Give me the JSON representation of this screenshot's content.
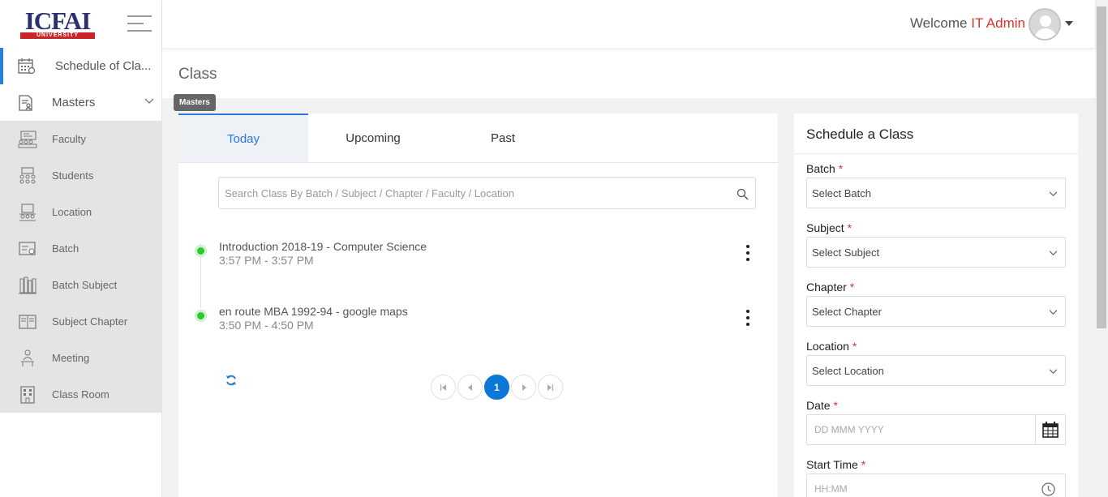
{
  "app": {
    "logo_text": "ICFAI",
    "logo_subtext": "UNIVERSITY"
  },
  "header": {
    "welcome_label": "Welcome",
    "user_name": "IT Admin"
  },
  "sidebar": {
    "items": [
      {
        "label": "Schedule of Cla...",
        "icon": "calendar-icon",
        "active": true
      },
      {
        "label": "Masters",
        "icon": "masters-icon",
        "expanded": true
      }
    ],
    "submenu": [
      {
        "label": "Faculty",
        "icon": "faculty-icon"
      },
      {
        "label": "Students",
        "icon": "students-icon"
      },
      {
        "label": "Location",
        "icon": "location-icon"
      },
      {
        "label": "Batch",
        "icon": "batch-icon"
      },
      {
        "label": "Batch Subject",
        "icon": "batch-subject-icon"
      },
      {
        "label": "Subject Chapter",
        "icon": "subject-chapter-icon"
      },
      {
        "label": "Meeting",
        "icon": "meeting-icon"
      },
      {
        "label": "Class Room",
        "icon": "class-room-icon"
      }
    ]
  },
  "tooltip": {
    "text": "Masters"
  },
  "page": {
    "title": "Class"
  },
  "tabs": [
    {
      "label": "Today",
      "active": true
    },
    {
      "label": "Upcoming"
    },
    {
      "label": "Past"
    }
  ],
  "search": {
    "placeholder": "Search Class By Batch / Subject / Chapter / Faculty / Location"
  },
  "classes": [
    {
      "title": "Introduction 2018-19 - Computer Science",
      "time": "3:57 PM - 3:57 PM",
      "status_color": "#2ec72e"
    },
    {
      "title": "en route MBA 1992-94 - google maps",
      "time": "3:50 PM - 4:50 PM",
      "status_color": "#2ec72e"
    }
  ],
  "pagination": {
    "current_page": "1"
  },
  "form": {
    "title": "Schedule a Class",
    "required_mark": "*",
    "fields": {
      "batch": {
        "label": "Batch",
        "value": "Select Batch"
      },
      "subject": {
        "label": "Subject",
        "value": "Select Subject"
      },
      "chapter": {
        "label": "Chapter",
        "value": "Select Chapter"
      },
      "location": {
        "label": "Location",
        "value": "Select Location"
      },
      "date": {
        "label": "Date",
        "placeholder": "DD MMM YYYY"
      },
      "start_time": {
        "label": "Start Time",
        "placeholder": "HH:MM"
      }
    }
  },
  "colors": {
    "accent": "#2a7ad6",
    "brand_red": "#d9342b",
    "status_live": "#2ec72e"
  }
}
